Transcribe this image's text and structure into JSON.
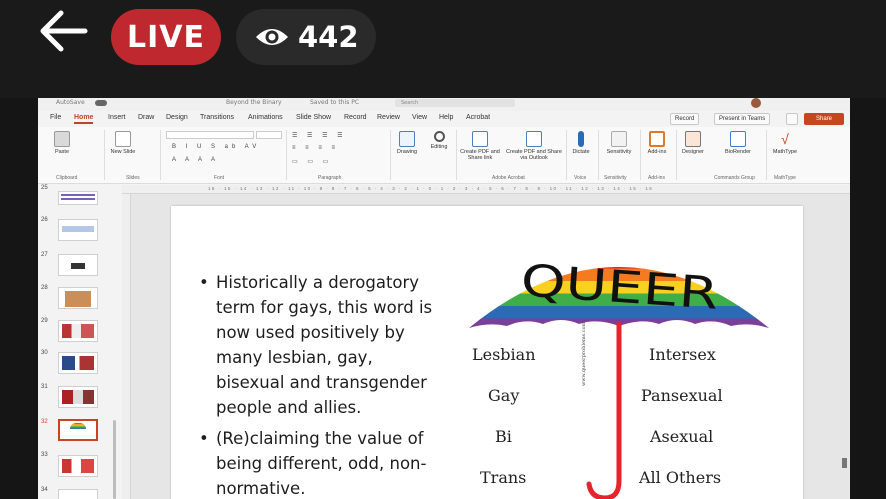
{
  "overlay": {
    "live_label": "LIVE",
    "viewer_count": "442",
    "icons": {
      "back": "arrow-left-icon",
      "viewers": "eye-icon"
    },
    "colors": {
      "live": "#c0282f",
      "bar": "#1a1a1a"
    }
  },
  "ppt": {
    "title_bar": {
      "autosave": "AutoSave",
      "file_name": "Beyond the Binary",
      "saved": "Saved to this PC",
      "search_placeholder": "Search"
    },
    "tabs": [
      "File",
      "Home",
      "Insert",
      "Draw",
      "Design",
      "Transitions",
      "Animations",
      "Slide Show",
      "Record",
      "Review",
      "View",
      "Help",
      "Acrobat"
    ],
    "active_tab": "Home",
    "record_button": "Record",
    "present_button": "Present in Teams",
    "share_button": "Share",
    "ribbon": {
      "paste": "Paste",
      "new_slide": "New Slide",
      "dictate": "Dictate",
      "drawing": "Drawing",
      "editing": "Editing",
      "create_pdf": "Create PDF and Share link",
      "create_pdf_outlook": "Create PDF and Share via Outlook",
      "sensitivity": "Sensitivity",
      "addins": "Add-ins",
      "designer": "Designer",
      "biorender": "BioRender",
      "mathtype": "MathType",
      "groups": {
        "clipboard": "Clipboard",
        "slides": "Slides",
        "font": "Font",
        "paragraph": "Paragraph",
        "adobe": "Adobe Acrobat",
        "voice": "Voice",
        "sensitivity": "Sensitivity",
        "addins": "Add-ins",
        "commands": "Commands Group",
        "mathtype": "MathType"
      }
    },
    "ruler_ticks": "16 · 15 · 14 · 13 · 12 · 11 · 10 · 9 · 8 · 7 · 6 · 5 · 4 · 3 · 2 · 1 · 0 · 1 · 2 · 3 · 4 · 5 · 6 · 7 · 8 · 9 · 10 · 11 · 12 · 13 · 14 · 15 · 16",
    "thumbnails": [
      "25",
      "26",
      "27",
      "28",
      "29",
      "30",
      "31",
      "32",
      "33",
      "34"
    ],
    "selected_slide": "32",
    "slide": {
      "bullets": [
        "Historically a derogatory term for gays, this word is now used positively by many lesbian, gay, bisexual and transgender people and allies.",
        "(Re)claiming the value of being different, odd, non-normative."
      ],
      "umbrella_title": "QUEER",
      "left_labels": [
        "Lesbian",
        "Gay",
        "Bi",
        "Trans"
      ],
      "right_labels": [
        "Intersex",
        "Pansexual",
        "Asexual",
        "All Others"
      ],
      "watermark": "www.queerproblems.com",
      "rainbow": [
        "#e5242b",
        "#f47b20",
        "#f9d01e",
        "#3fae49",
        "#2b6bb5",
        "#7a3f98"
      ]
    }
  }
}
